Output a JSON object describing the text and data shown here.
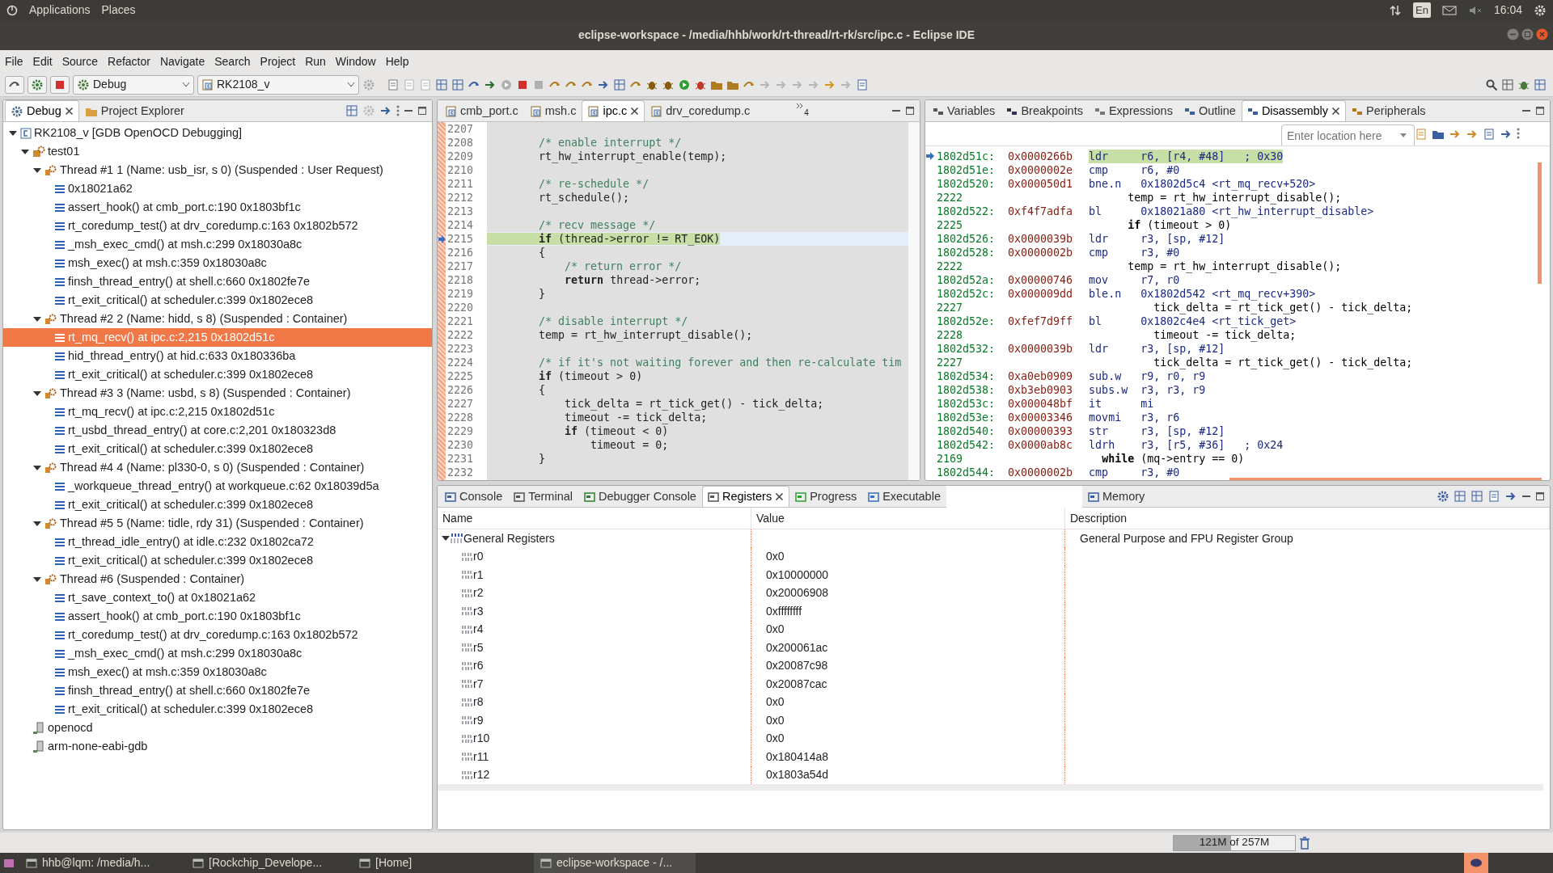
{
  "top_panel": {
    "menus": [
      "Applications",
      "Places"
    ],
    "keyboard": "En",
    "clock": "16:04"
  },
  "window": {
    "title": "eclipse-workspace - /media/hhb/work/rt-thread/rt-rk/src/ipc.c - Eclipse IDE"
  },
  "menu_bar": [
    "File",
    "Edit",
    "Source",
    "Refactor",
    "Navigate",
    "Search",
    "Project",
    "Run",
    "Window",
    "Help"
  ],
  "toolbar": {
    "launch_mode": "Debug",
    "launch_config": "RK2108_v"
  },
  "debug_view": {
    "tabs": [
      {
        "label": "Debug",
        "selected": true
      },
      {
        "label": "Project Explorer",
        "selected": false
      }
    ],
    "tree": [
      {
        "kind": "launch",
        "label": "RK2108_v [GDB OpenOCD Debugging]",
        "expanded": true,
        "selected": false,
        "children": [
          {
            "kind": "process",
            "label": "test01",
            "expanded": true,
            "selected": false,
            "children": [
              {
                "kind": "thread",
                "label": "Thread #1 1 (Name: usb_isr, s 0) (Suspended : User Request)",
                "expanded": true,
                "selected": false,
                "children": [
                  {
                    "kind": "frame",
                    "label": "0x18021a62",
                    "selected": false
                  },
                  {
                    "kind": "frame",
                    "label": "assert_hook() at cmb_port.c:190 0x1803bf1c",
                    "selected": false
                  },
                  {
                    "kind": "frame",
                    "label": "rt_coredump_test() at drv_coredump.c:163 0x1802b572",
                    "selected": false
                  },
                  {
                    "kind": "frame",
                    "label": "_msh_exec_cmd() at msh.c:299 0x18030a8c",
                    "selected": false
                  },
                  {
                    "kind": "frame",
                    "label": "msh_exec() at msh.c:359 0x18030a8c",
                    "selected": false
                  },
                  {
                    "kind": "frame",
                    "label": "finsh_thread_entry() at shell.c:660 0x1802fe7e",
                    "selected": false
                  },
                  {
                    "kind": "frame",
                    "label": "rt_exit_critical() at scheduler.c:399 0x1802ece8",
                    "selected": false
                  }
                ]
              },
              {
                "kind": "thread",
                "label": "Thread #2 2 (Name: hidd, s 8) (Suspended : Container)",
                "expanded": true,
                "selected": false,
                "children": [
                  {
                    "kind": "frame",
                    "label": "rt_mq_recv() at ipc.c:2,215 0x1802d51c",
                    "selected": true
                  },
                  {
                    "kind": "frame",
                    "label": "hid_thread_entry() at hid.c:633 0x180336ba",
                    "selected": false
                  },
                  {
                    "kind": "frame",
                    "label": "rt_exit_critical() at scheduler.c:399 0x1802ece8",
                    "selected": false
                  }
                ]
              },
              {
                "kind": "thread",
                "label": "Thread #3 3 (Name: usbd, s 8) (Suspended : Container)",
                "expanded": true,
                "selected": false,
                "children": [
                  {
                    "kind": "frame",
                    "label": "rt_mq_recv() at ipc.c:2,215 0x1802d51c",
                    "selected": false
                  },
                  {
                    "kind": "frame",
                    "label": "rt_usbd_thread_entry() at core.c:2,201 0x180323d8",
                    "selected": false
                  },
                  {
                    "kind": "frame",
                    "label": "rt_exit_critical() at scheduler.c:399 0x1802ece8",
                    "selected": false
                  }
                ]
              },
              {
                "kind": "thread",
                "label": "Thread #4 4 (Name: pl330-0, s 0) (Suspended : Container)",
                "expanded": true,
                "selected": false,
                "children": [
                  {
                    "kind": "frame",
                    "label": "_workqueue_thread_entry() at workqueue.c:62 0x18039d5a",
                    "selected": false
                  },
                  {
                    "kind": "frame",
                    "label": "rt_exit_critical() at scheduler.c:399 0x1802ece8",
                    "selected": false
                  }
                ]
              },
              {
                "kind": "thread",
                "label": "Thread #5 5 (Name: tidle, rdy 31) (Suspended : Container)",
                "expanded": true,
                "selected": false,
                "children": [
                  {
                    "kind": "frame",
                    "label": "rt_thread_idle_entry() at idle.c:232 0x1802ca72",
                    "selected": false
                  },
                  {
                    "kind": "frame",
                    "label": "rt_exit_critical() at scheduler.c:399 0x1802ece8",
                    "selected": false
                  }
                ]
              },
              {
                "kind": "thread",
                "label": "Thread #6 (Suspended : Container)",
                "expanded": true,
                "selected": false,
                "children": [
                  {
                    "kind": "frame",
                    "label": "rt_save_context_to() at 0x18021a62",
                    "selected": false
                  },
                  {
                    "kind": "frame",
                    "label": "assert_hook() at cmb_port.c:190 0x1803bf1c",
                    "selected": false
                  },
                  {
                    "kind": "frame",
                    "label": "rt_coredump_test() at drv_coredump.c:163 0x1802b572",
                    "selected": false
                  },
                  {
                    "kind": "frame",
                    "label": "_msh_exec_cmd() at msh.c:299 0x18030a8c",
                    "selected": false
                  },
                  {
                    "kind": "frame",
                    "label": "msh_exec() at msh.c:359 0x18030a8c",
                    "selected": false
                  },
                  {
                    "kind": "frame",
                    "label": "finsh_thread_entry() at shell.c:660 0x1802fe7e",
                    "selected": false
                  },
                  {
                    "kind": "frame",
                    "label": "rt_exit_critical() at scheduler.c:399 0x1802ece8",
                    "selected": false
                  }
                ]
              }
            ]
          },
          {
            "kind": "tool",
            "label": "openocd",
            "selected": false
          },
          {
            "kind": "tool",
            "label": "arm-none-eabi-gdb",
            "selected": false
          }
        ]
      }
    ]
  },
  "editor": {
    "tabs": [
      {
        "label": "cmb_port.c",
        "selected": false
      },
      {
        "label": "msh.c",
        "selected": false
      },
      {
        "label": "ipc.c",
        "selected": true
      },
      {
        "label": "drv_coredump.c",
        "selected": false
      }
    ],
    "overflow_count": "4",
    "lines": [
      {
        "number": "2207",
        "kind": "code",
        "current": false
      },
      {
        "number": "2208",
        "kind": "comment",
        "code": "        /* enable interrupt */",
        "current": false
      },
      {
        "number": "2209",
        "kind": "code",
        "code": "        rt_hw_interrupt_enable(temp);",
        "current": false
      },
      {
        "number": "2210",
        "kind": "code",
        "current": false
      },
      {
        "number": "2211",
        "kind": "comment",
        "code": "        /* re-schedule */",
        "current": false
      },
      {
        "number": "2212",
        "kind": "code",
        "code": "        rt_schedule();",
        "current": false
      },
      {
        "number": "2213",
        "kind": "code",
        "current": false
      },
      {
        "number": "2214",
        "kind": "comment",
        "code": "        /* recv message */",
        "current": false
      },
      {
        "number": "2215",
        "kind": "code",
        "code": "        **if** (thread->error != RT_EOK)",
        "current": true
      },
      {
        "number": "2216",
        "kind": "code",
        "code": "        {",
        "current": false
      },
      {
        "number": "2217",
        "kind": "comment",
        "code": "            /* return error */",
        "current": false
      },
      {
        "number": "2218",
        "kind": "code",
        "code": "            **return** thread->error;",
        "current": false
      },
      {
        "number": "2219",
        "kind": "code",
        "code": "        }",
        "current": false
      },
      {
        "number": "2220",
        "kind": "code",
        "current": false
      },
      {
        "number": "2221",
        "kind": "comment",
        "code": "        /* disable interrupt */",
        "current": false
      },
      {
        "number": "2222",
        "kind": "code",
        "code": "        temp = rt_hw_interrupt_disable();",
        "current": false
      },
      {
        "number": "2223",
        "kind": "code",
        "current": false
      },
      {
        "number": "2224",
        "kind": "comment",
        "code": "        /* if it's not waiting forever and then re-calculate tim",
        "current": false
      },
      {
        "number": "2225",
        "kind": "code",
        "code": "        **if** (timeout > 0)",
        "current": false
      },
      {
        "number": "2226",
        "kind": "code",
        "code": "        {",
        "current": false
      },
      {
        "number": "2227",
        "kind": "code",
        "code": "            tick_delta = rt_tick_get() - tick_delta;",
        "current": false
      },
      {
        "number": "2228",
        "kind": "code",
        "code": "            timeout -= tick_delta;",
        "current": false
      },
      {
        "number": "2229",
        "kind": "code",
        "code": "            **if** (timeout < 0)",
        "current": false
      },
      {
        "number": "2230",
        "kind": "code",
        "code": "                timeout = 0;",
        "current": false
      },
      {
        "number": "2231",
        "kind": "code",
        "code": "        }",
        "current": false
      },
      {
        "number": "2232",
        "kind": "code",
        "current": false
      }
    ]
  },
  "side_view": {
    "tabs": [
      {
        "label": "Variables",
        "selected": false
      },
      {
        "label": "Breakpoints",
        "selected": false
      },
      {
        "label": "Expressions",
        "selected": false
      },
      {
        "label": "Outline",
        "selected": false
      },
      {
        "label": "Disassembly",
        "selected": true
      },
      {
        "label": "Peripherals",
        "selected": false
      }
    ],
    "location_placeholder": "Enter location here",
    "rows": [
      {
        "kind": "instruction",
        "address": "1802d51c:",
        "opcode": "0x0000266b",
        "mnemonic": "ldr",
        "operands": "r6, [r4, #48]   ; 0x30",
        "current": true
      },
      {
        "kind": "instruction",
        "address": "1802d51e:",
        "opcode": "0x0000002e",
        "mnemonic": "cmp",
        "operands": "r6, #0",
        "current": false
      },
      {
        "kind": "instruction",
        "address": "1802d520:",
        "opcode": "0x000050d1",
        "mnemonic": "bne.n",
        "operands": "0x1802d5c4 <rt_mq_recv+520>",
        "current": false
      },
      {
        "kind": "source",
        "line": "2222",
        "text": "      temp = rt_hw_interrupt_disable();"
      },
      {
        "kind": "instruction",
        "address": "1802d522:",
        "opcode": "0xf4f7adfa",
        "mnemonic": "bl",
        "operands": "0x18021a80 <rt_hw_interrupt_disable>",
        "current": false
      },
      {
        "kind": "source",
        "line": "2225",
        "text": "      **if** (timeout > 0)"
      },
      {
        "kind": "instruction",
        "address": "1802d526:",
        "opcode": "0x0000039b",
        "mnemonic": "ldr",
        "operands": "r3, [sp, #12]",
        "current": false
      },
      {
        "kind": "instruction",
        "address": "1802d528:",
        "opcode": "0x0000002b",
        "mnemonic": "cmp",
        "operands": "r3, #0",
        "current": false
      },
      {
        "kind": "source",
        "line": "2222",
        "text": "      temp = rt_hw_interrupt_disable();"
      },
      {
        "kind": "instruction",
        "address": "1802d52a:",
        "opcode": "0x00000746",
        "mnemonic": "mov",
        "operands": "r7, r0",
        "current": false
      },
      {
        "kind": "instruction",
        "address": "1802d52c:",
        "opcode": "0x000009dd",
        "mnemonic": "ble.n",
        "operands": "0x1802d542 <rt_mq_recv+390>",
        "current": false
      },
      {
        "kind": "source",
        "line": "2227",
        "text": "          tick_delta = rt_tick_get() - tick_delta;"
      },
      {
        "kind": "instruction",
        "address": "1802d52e:",
        "opcode": "0xfef7d9ff",
        "mnemonic": "bl",
        "operands": "0x1802c4e4 <rt_tick_get>",
        "current": false
      },
      {
        "kind": "source",
        "line": "2228",
        "text": "          timeout -= tick_delta;"
      },
      {
        "kind": "instruction",
        "address": "1802d532:",
        "opcode": "0x0000039b",
        "mnemonic": "ldr",
        "operands": "r3, [sp, #12]",
        "current": false
      },
      {
        "kind": "source",
        "line": "2227",
        "text": "          tick_delta = rt_tick_get() - tick_delta;"
      },
      {
        "kind": "instruction",
        "address": "1802d534:",
        "opcode": "0xa0eb0909",
        "mnemonic": "sub.w",
        "operands": "r9, r0, r9",
        "current": false
      },
      {
        "kind": "instruction",
        "address": "1802d538:",
        "opcode": "0xb3eb0903",
        "mnemonic": "subs.w",
        "operands": "r3, r3, r9",
        "current": false
      },
      {
        "kind": "instruction",
        "address": "1802d53c:",
        "opcode": "0x000048bf",
        "mnemonic": "it",
        "operands": "mi",
        "current": false
      },
      {
        "kind": "instruction",
        "address": "1802d53e:",
        "opcode": "0x00003346",
        "mnemonic": "movmi",
        "operands": "r3, r6",
        "current": false
      },
      {
        "kind": "instruction",
        "address": "1802d540:",
        "opcode": "0x00000393",
        "mnemonic": "str",
        "operands": "r3, [sp, #12]",
        "current": false
      },
      {
        "kind": "instruction",
        "address": "1802d542:",
        "opcode": "0x0000ab8c",
        "mnemonic": "ldrh",
        "operands": "r3, [r5, #36]   ; 0x24",
        "current": false
      },
      {
        "kind": "source",
        "line": "2169",
        "text": "  **while** (mq->entry == 0)"
      },
      {
        "kind": "instruction",
        "address": "1802d544:",
        "opcode": "0x0000002b",
        "mnemonic": "cmp",
        "operands": "r3, #0",
        "current": false
      }
    ]
  },
  "bottom_view": {
    "tabs": [
      {
        "label": "Console",
        "selected": false
      },
      {
        "label": "Terminal",
        "selected": false
      },
      {
        "label": "Debugger Console",
        "selected": false
      },
      {
        "label": "Registers",
        "selected": true
      },
      {
        "label": "Progress",
        "selected": false
      },
      {
        "label": "Executable",
        "selected": false
      },
      {
        "label": "Memory",
        "selected": false
      }
    ],
    "columns": [
      "Name",
      "Value",
      "Description"
    ],
    "group": {
      "name": "General Registers",
      "description": "General Purpose and FPU Register Group",
      "expanded": true
    },
    "registers": [
      {
        "name": "r0",
        "value": "0x0"
      },
      {
        "name": "r1",
        "value": "0x10000000"
      },
      {
        "name": "r2",
        "value": "0x20006908"
      },
      {
        "name": "r3",
        "value": "0xffffffff"
      },
      {
        "name": "r4",
        "value": "0x0"
      },
      {
        "name": "r5",
        "value": "0x200061ac"
      },
      {
        "name": "r6",
        "value": "0x20087c98"
      },
      {
        "name": "r7",
        "value": "0x20087cac"
      },
      {
        "name": "r8",
        "value": "0x0"
      },
      {
        "name": "r9",
        "value": "0x0"
      },
      {
        "name": "r10",
        "value": "0x0"
      },
      {
        "name": "r11",
        "value": "0x180414a8"
      },
      {
        "name": "r12",
        "value": "0x1803a54d"
      }
    ]
  },
  "status_bar": {
    "heap": "121M of 257M",
    "level": 0.47
  },
  "taskbar": [
    {
      "label": "hhb@lqm: /media/h..."
    },
    {
      "label": "[Rockchip_Develope..."
    },
    {
      "label": "[Home]"
    },
    {
      "label": "eclipse-workspace - /..."
    }
  ]
}
